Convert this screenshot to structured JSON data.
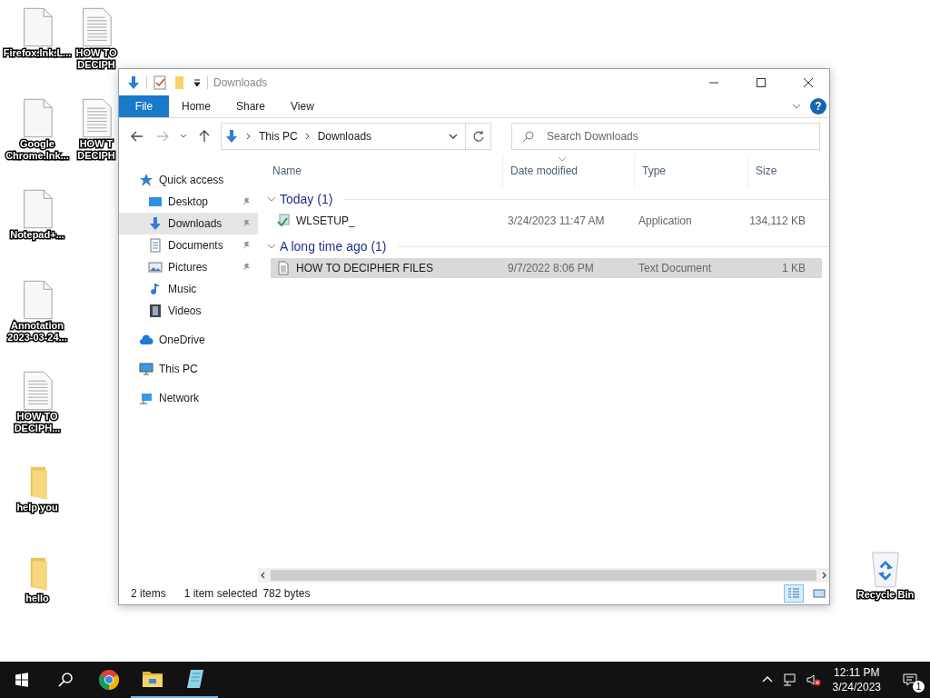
{
  "desktop": {
    "icons": [
      {
        "label": "Firefox.lnk.L...",
        "kind": "file"
      },
      {
        "label": "Google Chrome.lnk...",
        "kind": "file"
      },
      {
        "label": "Notepad+...",
        "kind": "file"
      },
      {
        "label": "Annotation 2023-03-24...",
        "kind": "file"
      },
      {
        "label": "HOW TO DECIPH...",
        "kind": "text"
      },
      {
        "label": "help you",
        "kind": "folder"
      },
      {
        "label": "hello",
        "kind": "folder"
      }
    ],
    "icons_second_column": [
      {
        "label": "HOW TO DECIPH",
        "kind": "text"
      },
      {
        "label": "HOW T DECIPH",
        "kind": "text"
      }
    ],
    "recycle_bin": {
      "label": "Recycle Bin"
    }
  },
  "window": {
    "title": "Downloads",
    "ribbon_tabs": [
      {
        "label": "File",
        "kind": "file"
      },
      {
        "label": "Home",
        "kind": "tab"
      },
      {
        "label": "Share",
        "kind": "tab"
      },
      {
        "label": "View",
        "kind": "tab"
      }
    ],
    "help": "?",
    "breadcrumb": [
      "This PC",
      "Downloads"
    ],
    "search": {
      "placeholder": "Search Downloads"
    },
    "nav_items": [
      {
        "label": "Quick access",
        "kind": "star",
        "selected": false,
        "children": [
          {
            "label": "Desktop",
            "kind": "desktop",
            "pinned": true,
            "selected": false
          },
          {
            "label": "Downloads",
            "kind": "download",
            "pinned": true,
            "selected": true
          },
          {
            "label": "Documents",
            "kind": "documents",
            "pinned": true,
            "selected": false
          },
          {
            "label": "Pictures",
            "kind": "pictures",
            "pinned": true,
            "selected": false
          },
          {
            "label": "Music",
            "kind": "music",
            "pinned": false,
            "selected": false
          },
          {
            "label": "Videos",
            "kind": "videos",
            "pinned": false,
            "selected": false
          }
        ]
      },
      {
        "label": "OneDrive",
        "kind": "cloud",
        "selected": false
      },
      {
        "label": "This PC",
        "kind": "pc",
        "selected": false
      },
      {
        "label": "Network",
        "kind": "network",
        "selected": false
      }
    ],
    "columns": [
      "Name",
      "Date modified",
      "Type",
      "Size"
    ],
    "groups": [
      {
        "title": "Today (1)",
        "expanded": true,
        "files": [
          {
            "name": "WLSETUP_",
            "kind": "app",
            "date": "3/24/2023 11:47 AM",
            "type": "Application",
            "size": "134,112 KB",
            "selected": false
          }
        ]
      },
      {
        "title": "A long time ago (1)",
        "expanded": true,
        "files": [
          {
            "name": "HOW TO DECIPHER FILES",
            "kind": "text",
            "date": "9/7/2022 8:06 PM",
            "type": "Text Document",
            "size": "1 KB",
            "selected": true
          }
        ]
      }
    ],
    "status": {
      "items": "2 items",
      "selection": "1 item selected",
      "size": "782 bytes"
    },
    "views": [
      {
        "kind": "details",
        "selected": true
      },
      {
        "kind": "large",
        "selected": false
      }
    ]
  },
  "taskbar": {
    "apps": [
      {
        "kind": "chrome",
        "running": false
      },
      {
        "kind": "explorer",
        "running": true
      },
      {
        "kind": "notepad",
        "running": true
      }
    ],
    "time": "12:11 PM",
    "date": "3/24/2023",
    "notifications": "1"
  }
}
